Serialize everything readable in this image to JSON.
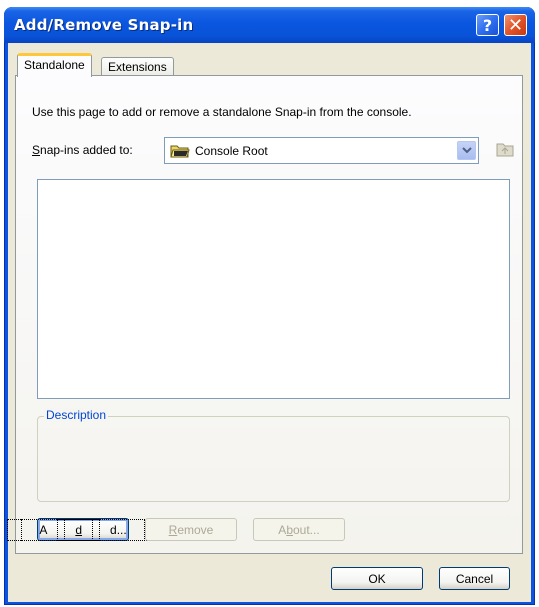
{
  "window": {
    "title": "Add/Remove Snap-in",
    "help_button": "?",
    "close_button": "✕"
  },
  "tabs": [
    {
      "label": "Standalone",
      "active": true
    },
    {
      "label": "Extensions",
      "active": false
    }
  ],
  "standalone": {
    "intro_text": "Use this page to add or remove a standalone Snap-in from the console.",
    "combo_label_mnemonic": "S",
    "combo_label_rest": "nap-ins added to:",
    "combo_value": "Console Root",
    "combo_icon": "folder-icon",
    "up_icon": "up-folder-icon",
    "snapins": [],
    "description_label": "Description",
    "description_text": ""
  },
  "buttons": {
    "add": {
      "pre": "A",
      "mnemonic": "d",
      "post": "d...",
      "enabled": true
    },
    "remove": {
      "pre": "",
      "mnemonic": "R",
      "post": "emove",
      "enabled": false
    },
    "about": {
      "pre": "A",
      "mnemonic": "b",
      "post": "out...",
      "enabled": false
    },
    "ok": "OK",
    "cancel": "Cancel"
  },
  "colors": {
    "titlebar": "#0a54e0",
    "face": "#ece9d8",
    "group_label": "#0046d5",
    "tab_highlight": "#ffc83c"
  }
}
